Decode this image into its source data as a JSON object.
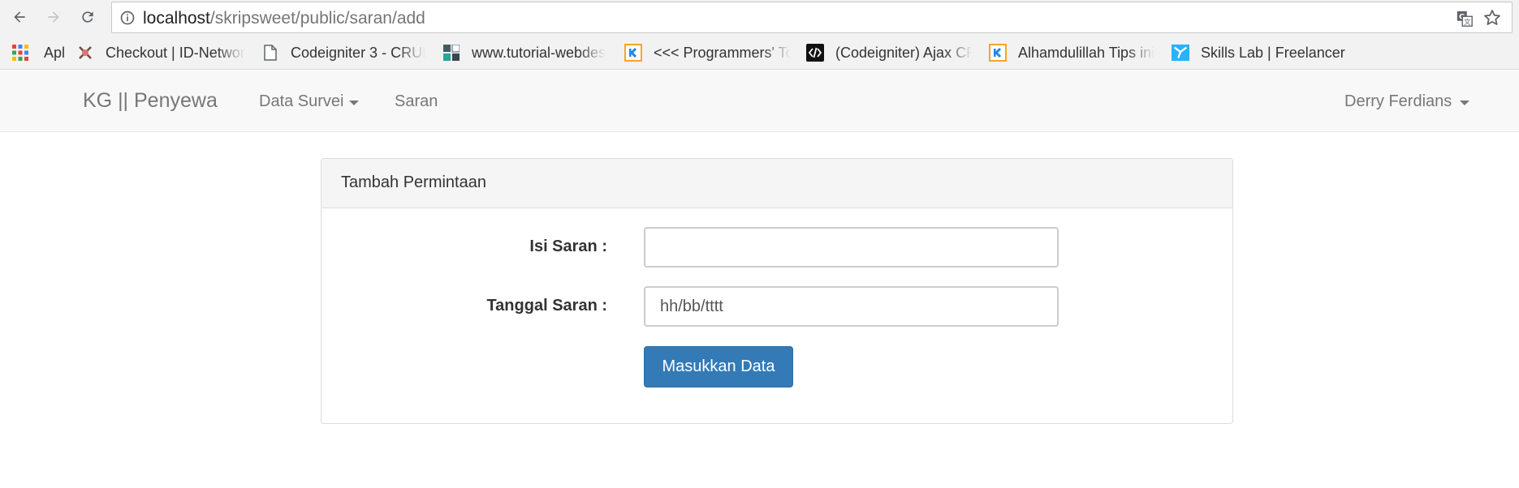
{
  "browser": {
    "url_host": "localhost",
    "url_path": "/skripsweet/public/saran/add",
    "bookmarks": [
      {
        "label": "Apl",
        "icon": "apps-grid-icon"
      },
      {
        "label": "Checkout | ID-Networ",
        "icon": "idnetworks-icon"
      },
      {
        "label": "Codeigniter 3 - CRUD",
        "icon": "page-icon"
      },
      {
        "label": "www.tutorial-webdes",
        "icon": "tutorial-webdesign-icon"
      },
      {
        "label": "<<< Programmers' To",
        "icon": "kodesource-icon"
      },
      {
        "label": "(Codeigniter) Ajax CR",
        "icon": "code-brackets-icon"
      },
      {
        "label": "Alhamdulillah Tips ini",
        "icon": "kodesource-icon"
      },
      {
        "label": "Skills Lab | Freelancer",
        "icon": "freelancer-icon"
      }
    ]
  },
  "navbar": {
    "brand": "KG || Penyewa",
    "links": [
      "Data Survei",
      "Saran"
    ],
    "user": "Derry Ferdians"
  },
  "panel": {
    "heading": "Tambah Permintaan",
    "fields": [
      {
        "label": "Isi Saran :",
        "value": "",
        "placeholder": ""
      },
      {
        "label": "Tanggal Saran :",
        "value": "",
        "placeholder": "hh/bb/tttt"
      }
    ],
    "submit_label": "Masukkan Data"
  },
  "colors": {
    "primary": "#337ab7",
    "navbar_bg": "#f8f8f8",
    "panel_heading_bg": "#f5f5f5"
  }
}
